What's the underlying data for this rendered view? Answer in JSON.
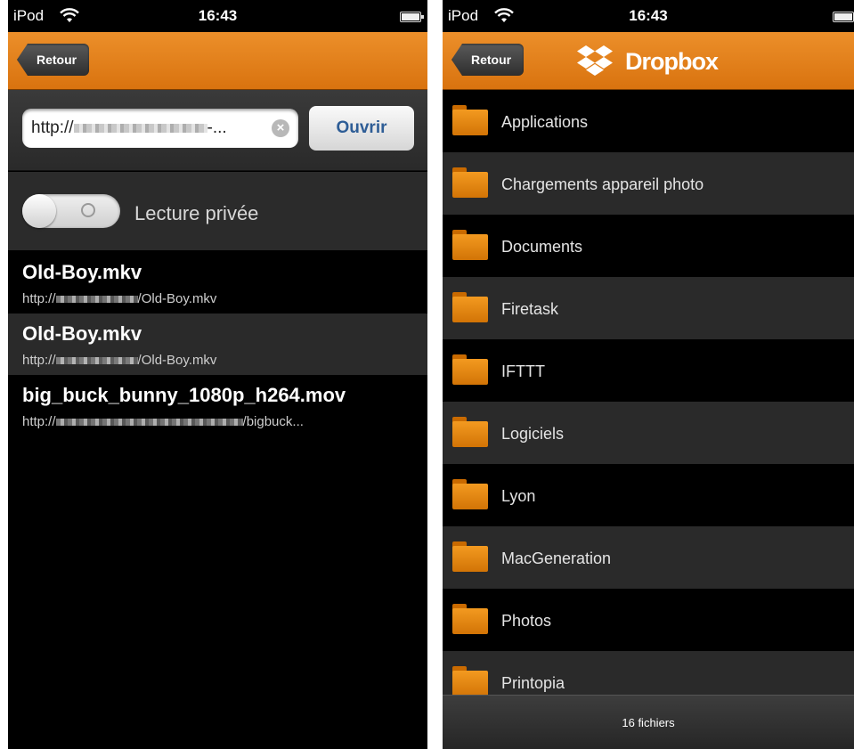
{
  "colors": {
    "accent": "#e07f1a",
    "folder": "#ef9118",
    "link_blue": "#2e5d96"
  },
  "left": {
    "status": {
      "carrier": "iPod",
      "time": "16:43"
    },
    "nav": {
      "back_label": "Retour"
    },
    "url_bar": {
      "url_prefix": "http://",
      "url_suffix": "-...",
      "open_label": "Ouvrir"
    },
    "private_mode": {
      "label": "Lecture privée",
      "enabled": false
    },
    "history": [
      {
        "title": "Old-Boy.mkv",
        "url_prefix": "http://",
        "url_suffix": "/Old-Boy.mkv"
      },
      {
        "title": "Old-Boy.mkv",
        "url_prefix": "http://",
        "url_suffix": "/Old-Boy.mkv"
      },
      {
        "title": "big_buck_bunny_1080p_h264.mov",
        "url_prefix": "http://",
        "url_suffix": "/bigbuck..."
      }
    ]
  },
  "right": {
    "status": {
      "carrier": "iPod",
      "time": "16:43"
    },
    "nav": {
      "back_label": "Retour",
      "title": "Dropbox"
    },
    "folders": [
      "Applications",
      "Chargements appareil photo",
      "Documents",
      "Firetask",
      "IFTTT",
      "Logiciels",
      "Lyon",
      "MacGeneration",
      "Photos",
      "Printopia"
    ],
    "footer": {
      "file_count": "16 fichiers"
    }
  }
}
